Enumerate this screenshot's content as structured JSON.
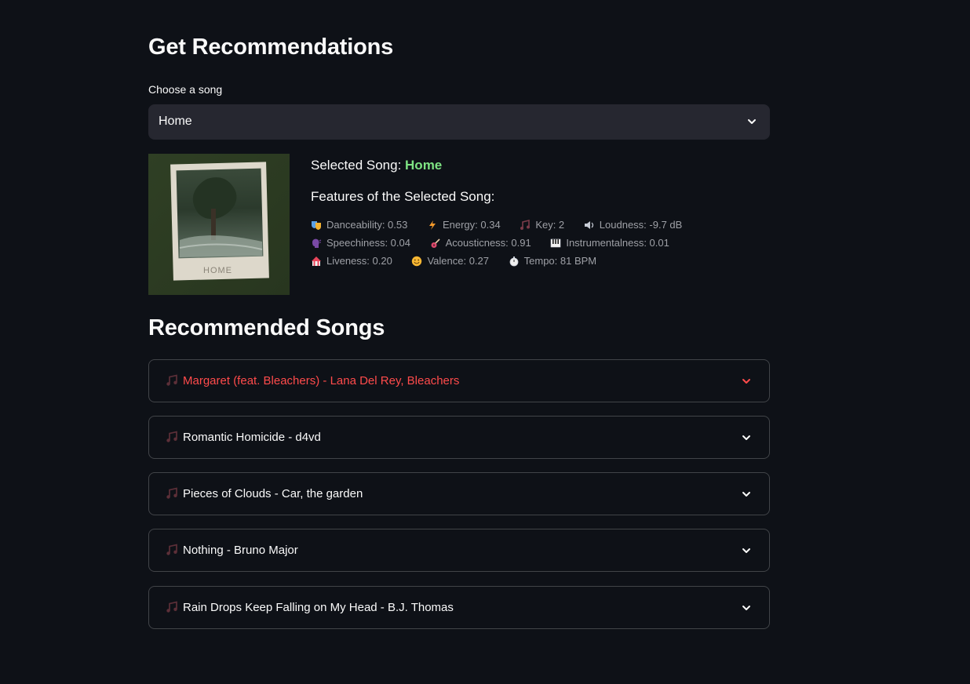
{
  "header": {
    "title": "Get Recommendations"
  },
  "select": {
    "label": "Choose a song",
    "value": "Home"
  },
  "selected": {
    "prefix": "Selected Song: ",
    "name": "Home",
    "cover_caption": "HOME"
  },
  "features": {
    "title": "Features of the Selected Song:",
    "rows": [
      [
        {
          "icon": "masks-icon",
          "label": "Danceability: 0.53"
        },
        {
          "icon": "lightning-icon",
          "label": "Energy: 0.34"
        },
        {
          "icon": "music-note-icon",
          "label": "Key: 2"
        },
        {
          "icon": "speaker-icon",
          "label": "Loudness: -9.7 dB"
        }
      ],
      [
        {
          "icon": "speaking-head-icon",
          "label": "Speechiness: 0.04"
        },
        {
          "icon": "guitar-icon",
          "label": "Acousticness: 0.91"
        },
        {
          "icon": "piano-icon",
          "label": "Instrumentalness: 0.01"
        }
      ],
      [
        {
          "icon": "circus-tent-icon",
          "label": "Liveness: 0.20"
        },
        {
          "icon": "smiley-icon",
          "label": "Valence: 0.27"
        },
        {
          "icon": "stopwatch-icon",
          "label": "Tempo: 81 BPM"
        }
      ]
    ]
  },
  "recommendations": {
    "title": "Recommended Songs",
    "items": [
      {
        "label": "Margaret (feat. Bleachers) - Lana Del Rey, Bleachers",
        "active": true
      },
      {
        "label": "Romantic Homicide - d4vd",
        "active": false
      },
      {
        "label": "Pieces of Clouds - Car, the garden",
        "active": false
      },
      {
        "label": "Nothing - Bruno Major",
        "active": false
      },
      {
        "label": "Rain Drops Keep Falling on My Head - B.J. Thomas",
        "active": false
      }
    ]
  },
  "colors": {
    "background": "#0e1117",
    "accent_red": "#ff4b4b",
    "selected_green": "#7ee383",
    "input_bg": "#262730"
  }
}
